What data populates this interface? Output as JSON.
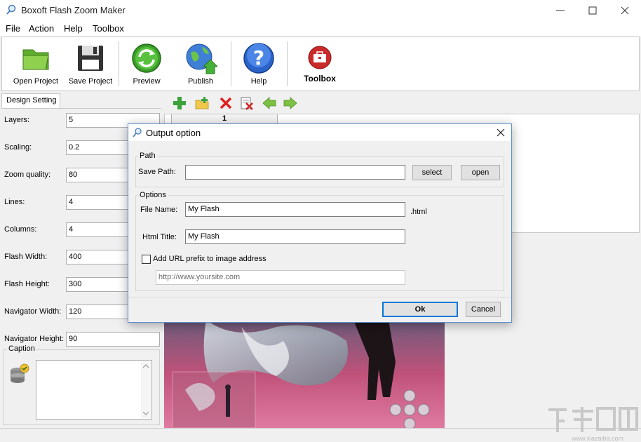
{
  "app": {
    "title": "Boxoft Flash Zoom Maker"
  },
  "menu": [
    "File",
    "Action",
    "Help",
    "Toolbox"
  ],
  "toolbar": {
    "open_project": "Open Project",
    "save_project": "Save Project",
    "preview": "Preview",
    "publish": "Publish",
    "help": "Help",
    "toolbox": "Toolbox"
  },
  "design": {
    "tab_label": "Design Setting",
    "fields": [
      {
        "label": "Layers:",
        "value": "5"
      },
      {
        "label": "Scaling:",
        "value": "0.2"
      },
      {
        "label": "Zoom quality:",
        "value": "80"
      },
      {
        "label": "Lines:",
        "value": "4"
      },
      {
        "label": "Columns:",
        "value": "4"
      },
      {
        "label": "Flash Width:",
        "value": "400"
      },
      {
        "label": "Flash Height:",
        "value": "300"
      },
      {
        "label": "Navigator Width:",
        "value": "120"
      },
      {
        "label": "Navigator Height:",
        "value": "90"
      }
    ],
    "caption_label": "Caption"
  },
  "layers": {
    "tab_label": "1"
  },
  "dialog": {
    "title": "Output option",
    "path_group": "Path",
    "save_path_label": "Save Path:",
    "save_path_value": "",
    "select_button": "select",
    "open_button": "open",
    "options_group": "Options",
    "file_name_label": "File Name:",
    "file_name_value": "My Flash",
    "file_ext": ".html",
    "html_title_label": "Html Title:",
    "html_title_value": "My Flash",
    "url_prefix_label": "Add URL prefix to image address",
    "url_prefix_checked": false,
    "url_value": "http://www.yoursite.com",
    "ok_button": "Ok",
    "cancel_button": "Cancel"
  },
  "watermark": {
    "url": "www.xiazaiba.com"
  },
  "colors": {
    "dialog_border": "#5b8fce",
    "ok_focus": "#0078d7"
  }
}
